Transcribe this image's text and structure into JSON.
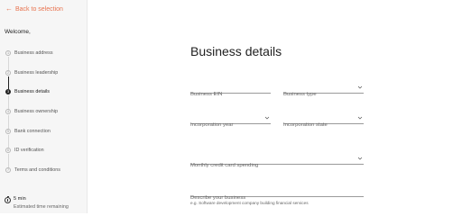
{
  "sidebar": {
    "back_label": "Back to selection",
    "welcome": "Welcome,",
    "steps": [
      {
        "num": "1",
        "label": "Business address"
      },
      {
        "num": "2",
        "label": "Business leadership"
      },
      {
        "num": "3",
        "label": "Business details"
      },
      {
        "num": "4",
        "label": "Business ownership"
      },
      {
        "num": "5",
        "label": "Bank connection"
      },
      {
        "num": "6",
        "label": "ID verification"
      },
      {
        "num": "7",
        "label": "Terms and conditions"
      }
    ],
    "active_step": 3,
    "time_value": "5 min",
    "time_label": "Estimated time remaining"
  },
  "main": {
    "title": "Business details",
    "fields": {
      "ein": "Business EIN",
      "type": "Business type",
      "year": "Incorporation year",
      "state": "Incorporation state",
      "spending": "Monthly credit card spending",
      "description": "Describe your business"
    },
    "description_hint": "e.g. Software development company building financial services"
  },
  "colors": {
    "accent": "#e8734f",
    "active_step": "#222222",
    "sidebar_bg": "#f6f6f6"
  }
}
